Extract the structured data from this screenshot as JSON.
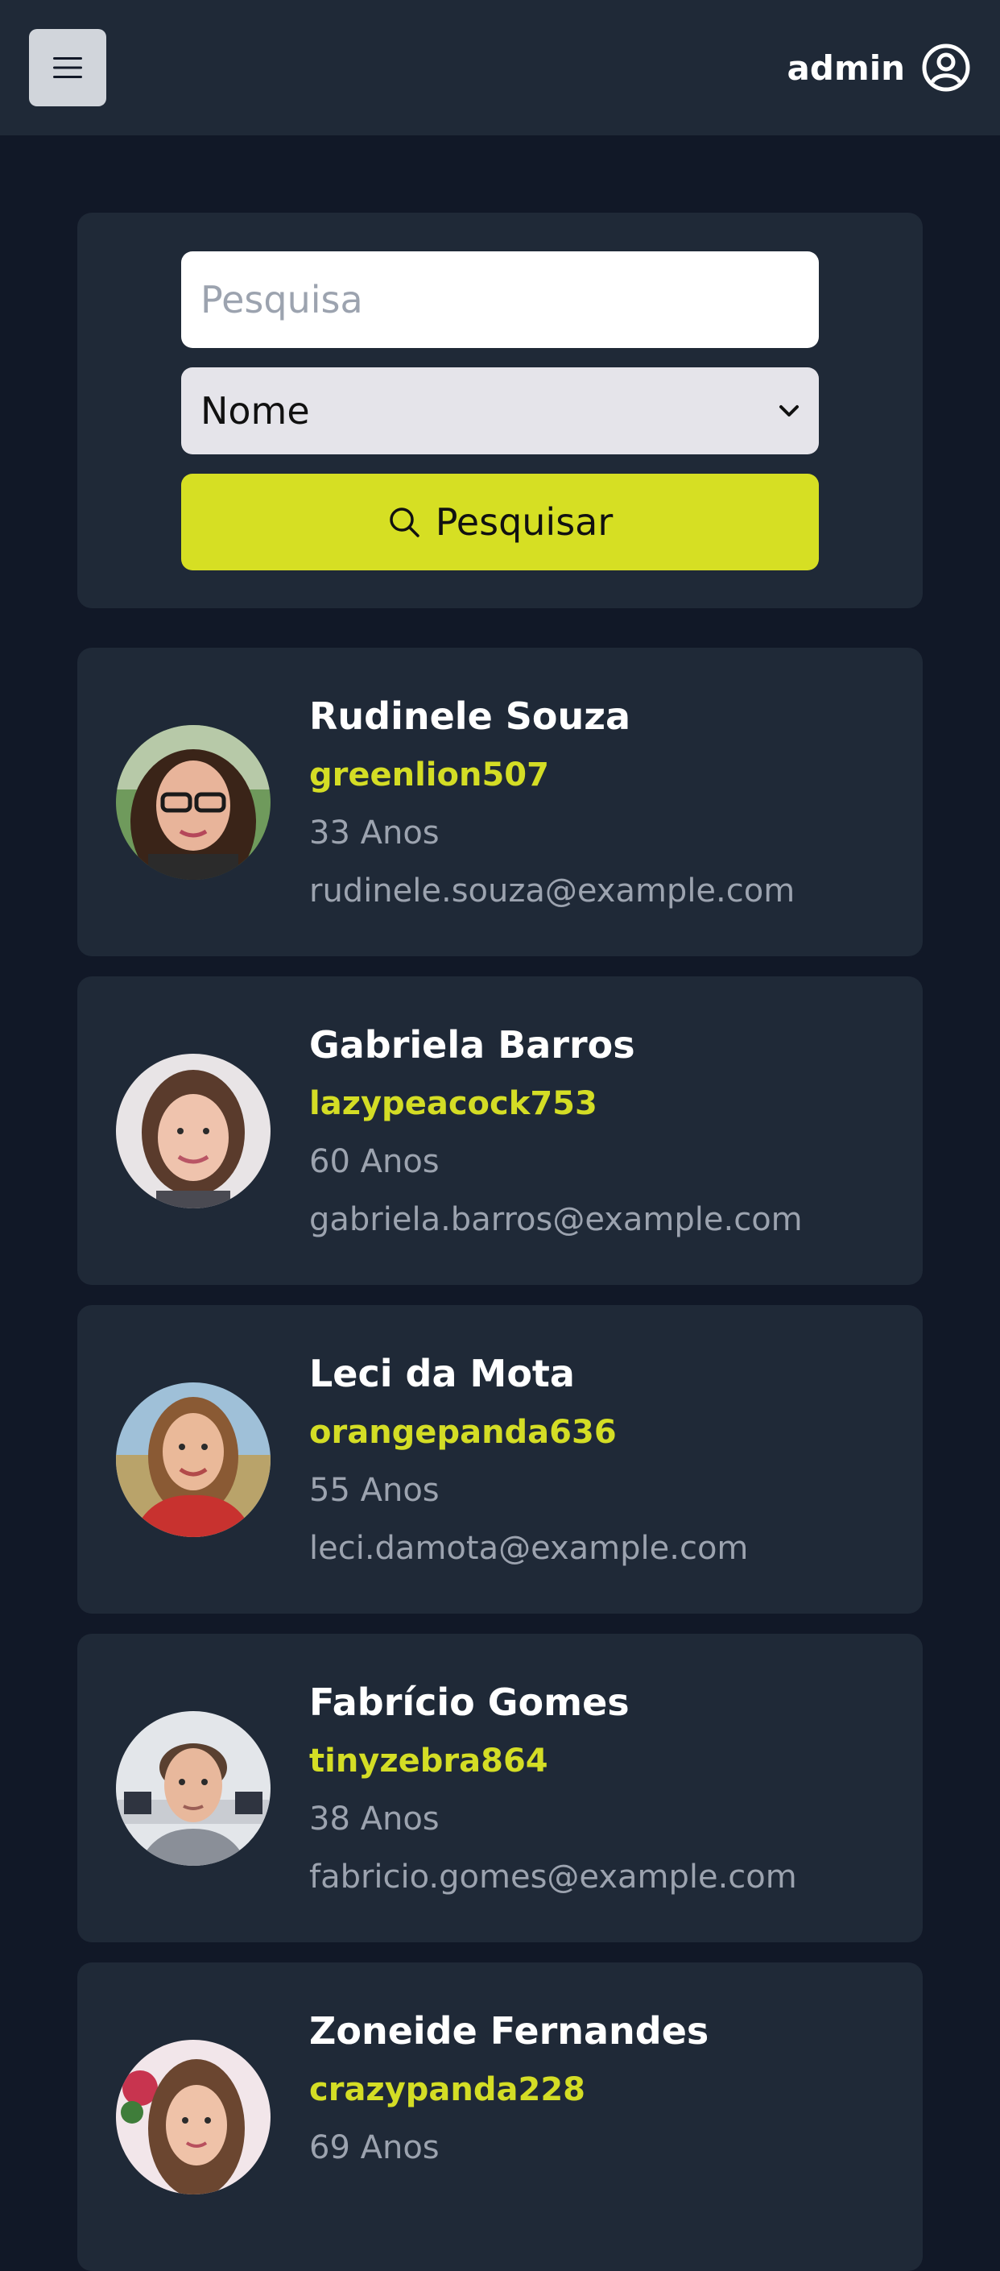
{
  "header": {
    "menu_icon": "hamburger-icon",
    "username": "admin",
    "user_icon": "user-circle-icon"
  },
  "search": {
    "placeholder": "Pesquisa",
    "value": "",
    "filter_selected": "Nome",
    "button_label": "Pesquisar",
    "button_icon": "search-icon"
  },
  "colors": {
    "background": "#111827",
    "surface": "#1f2937",
    "accent": "#d6df23",
    "muted_text": "#9ca3af"
  },
  "users": [
    {
      "name": "Rudinele Souza",
      "login": "greenlion507",
      "age": "33 Anos",
      "email": "rudinele.souza@example.com"
    },
    {
      "name": "Gabriela Barros",
      "login": "lazypeacock753",
      "age": "60 Anos",
      "email": "gabriela.barros@example.com"
    },
    {
      "name": "Leci da Mota",
      "login": "orangepanda636",
      "age": "55 Anos",
      "email": "leci.damota@example.com"
    },
    {
      "name": "Fabrício Gomes",
      "login": "tinyzebra864",
      "age": "38 Anos",
      "email": "fabricio.gomes@example.com"
    },
    {
      "name": "Zoneide Fernandes",
      "login": "crazypanda228",
      "age": "69 Anos",
      "email": ""
    }
  ]
}
